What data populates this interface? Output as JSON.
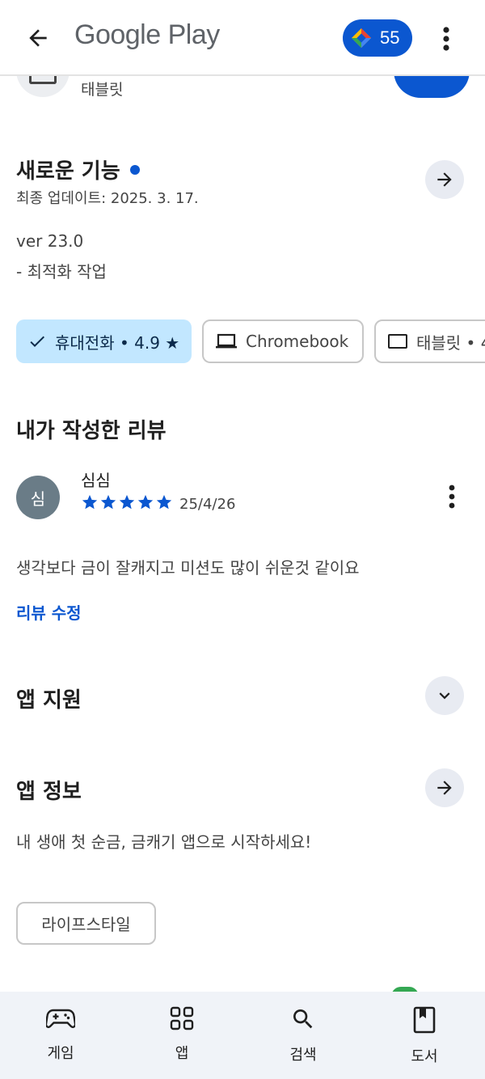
{
  "topbar": {
    "title": "Google Play",
    "points": "55"
  },
  "header_remnant": {
    "device_label": "태블릿"
  },
  "whats_new": {
    "title": "새로운 기능",
    "updated": "최종 업데이트: 2025. 3. 17.",
    "version": "ver 23.0",
    "notes": "- 최적화 작업"
  },
  "device_chips": [
    {
      "label": "휴대전화 • 4.9 ★",
      "selected": true
    },
    {
      "label": "Chromebook",
      "selected": false
    },
    {
      "label": "태블릿 • 4",
      "selected": false
    }
  ],
  "my_review": {
    "title": "내가 작성한 리뷰",
    "avatar_letter": "심",
    "author": "심심",
    "rating": 5,
    "date": "25/4/26",
    "text": "생각보다 금이 잘캐지고 미션도 많이 쉬운것 같이요",
    "edit_link": "리뷰 수정"
  },
  "app_support": {
    "title": "앱 지원"
  },
  "app_info": {
    "title": "앱 정보",
    "description": "내 생애 첫 순금, 금캐기 앱으로 시작하세요!",
    "category_tag": "라이프스타일"
  },
  "bottom_nav": [
    {
      "label": "게임",
      "icon": "gamepad-icon"
    },
    {
      "label": "앱",
      "icon": "apps-grid-icon"
    },
    {
      "label": "검색",
      "icon": "search-icon"
    },
    {
      "label": "도서",
      "icon": "book-icon"
    }
  ],
  "colors": {
    "accent": "#0b57d0",
    "chip_selected_bg": "#c2e7ff",
    "avatar_bg": "#6a7c87",
    "nav_bg": "#f0f3f8"
  }
}
